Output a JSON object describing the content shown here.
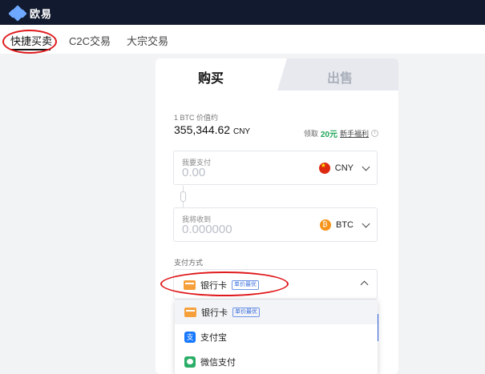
{
  "brand": {
    "name": "欧易",
    "logo_icon": "okx-logo-icon"
  },
  "subnav": {
    "tabs": [
      "快捷买卖",
      "C2C交易",
      "大宗交易"
    ],
    "active": 0
  },
  "trade": {
    "buy_tab": "购买",
    "sell_tab": "出售",
    "price_caption": "1 BTC 价值约",
    "price_value": "355,344.62",
    "price_unit": "CNY",
    "promo_prefix": "领取",
    "promo_amount": "20元",
    "promo_link": "新手福利",
    "pay_field": {
      "label": "我要支付",
      "placeholder": "0.00",
      "currency": "CNY",
      "currency_icon": "cny-flag-icon"
    },
    "receive_field": {
      "label": "我将收到",
      "placeholder": "0.000000",
      "currency": "BTC",
      "currency_icon": "btc-coin-icon"
    },
    "payment_method_title": "支付方式",
    "payment_selected": {
      "name": "银行卡",
      "tag": "单价最优",
      "icon": "bank-card-icon"
    },
    "payment_options": [
      {
        "name": "银行卡",
        "tag": "单价最优",
        "icon": "bank-card-icon"
      },
      {
        "name": "支付宝",
        "tag": "",
        "icon": "alipay-icon"
      },
      {
        "name": "微信支付",
        "tag": "",
        "icon": "wechat-pay-icon"
      }
    ]
  },
  "colors": {
    "topbar": "#111a2e",
    "accent": "#2b63e8",
    "promo_green": "#21a65a",
    "highlight_oval": "#e0191c"
  }
}
